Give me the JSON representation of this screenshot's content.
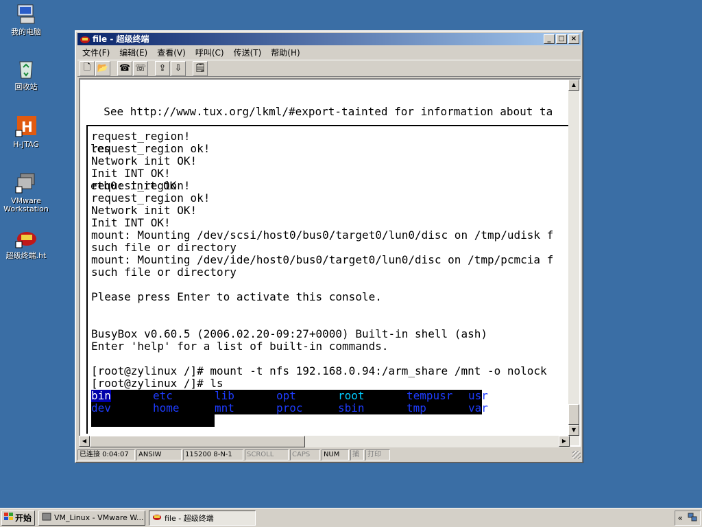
{
  "desktop": {
    "icons": [
      {
        "label": "我的电脑",
        "icon": "my-computer-icon"
      },
      {
        "label": "回收站",
        "icon": "recycle-bin-icon"
      },
      {
        "label": "H-JTAG",
        "icon": "hjtag-icon"
      },
      {
        "label": "VMware",
        "label2": "Workstation",
        "icon": "vmware-icon"
      },
      {
        "label": "超级终端.ht",
        "icon": "hyperterminal-icon"
      }
    ]
  },
  "window": {
    "title": "file - 超级终端",
    "min": "_",
    "max": "□",
    "close": "×"
  },
  "menu": [
    "文件(F)",
    "编辑(E)",
    "查看(V)",
    "呼叫(C)",
    "传送(T)",
    "帮助(H)"
  ],
  "toolbar": {
    "new": "🗋",
    "open": "📂",
    "disconnect": "☎",
    "call": "☏",
    "send": "⇪",
    "receive": "⇩",
    "properties": "🗒"
  },
  "terminal": {
    "outer_lines": [
      "  See http://www.tux.org/lkml/#export-tainted for information about ta",
      "les",
      "eth0: init OK"
    ],
    "inner_lines": [
      "request_region!",
      "request_region ok!",
      "Network init OK!",
      "Init INT OK!",
      "request_region!",
      "request_region ok!",
      "Network init OK!",
      "Init INT OK!",
      "mount: Mounting /dev/scsi/host0/bus0/target0/lun0/disc on /tmp/udisk f",
      "such file or directory",
      "mount: Mounting /dev/ide/host0/bus0/target0/lun0/disc on /tmp/pcmcia f",
      "such file or directory",
      "",
      "Please press Enter to activate this console.",
      "",
      "",
      "BusyBox v0.60.5 (2006.02.20-09:27+0000) Built-in shell (ash)",
      "Enter 'help' for a list of built-in commands.",
      "",
      "[root@zylinux /]# mount -t nfs 192.168.0.94:/arm_share /mnt -o nolock",
      "[root@zylinux /]# ls"
    ],
    "ls_rows": [
      [
        {
          "name": "bin",
          "color": "#ffffff",
          "bg": "#0000aa"
        },
        {
          "name": "etc",
          "color": "#1e3cff"
        },
        {
          "name": "lib",
          "color": "#1e3cff"
        },
        {
          "name": "opt",
          "color": "#1e3cff"
        },
        {
          "name": "root",
          "color": "#00ccff"
        },
        {
          "name": "tempusr",
          "color": "#1e3cff"
        },
        {
          "name": "usr",
          "color": "#1e3cff"
        }
      ],
      [
        {
          "name": "dev",
          "color": "#1e3cff"
        },
        {
          "name": "home",
          "color": "#1e3cff"
        },
        {
          "name": "mnt",
          "color": "#1e3cff"
        },
        {
          "name": "proc",
          "color": "#1e3cff"
        },
        {
          "name": "sbin",
          "color": "#1e3cff"
        },
        {
          "name": "tmp",
          "color": "#1e3cff"
        },
        {
          "name": "var",
          "color": "#1e3cff"
        }
      ]
    ],
    "prompt": "[root@zylinux /]# "
  },
  "status": {
    "connected": "已连接 0:04:07",
    "emulation": "ANSIW",
    "settings": "115200 8-N-1",
    "scroll": "SCROLL",
    "caps": "CAPS",
    "num": "NUM",
    "capture": "捕",
    "print": "打印"
  },
  "taskbar": {
    "start": "开始",
    "tasks": [
      {
        "label": "VM_Linux - VMware W...",
        "active": false
      },
      {
        "label": "file - 超级终端",
        "active": true
      }
    ],
    "tray_chevron": "«"
  }
}
